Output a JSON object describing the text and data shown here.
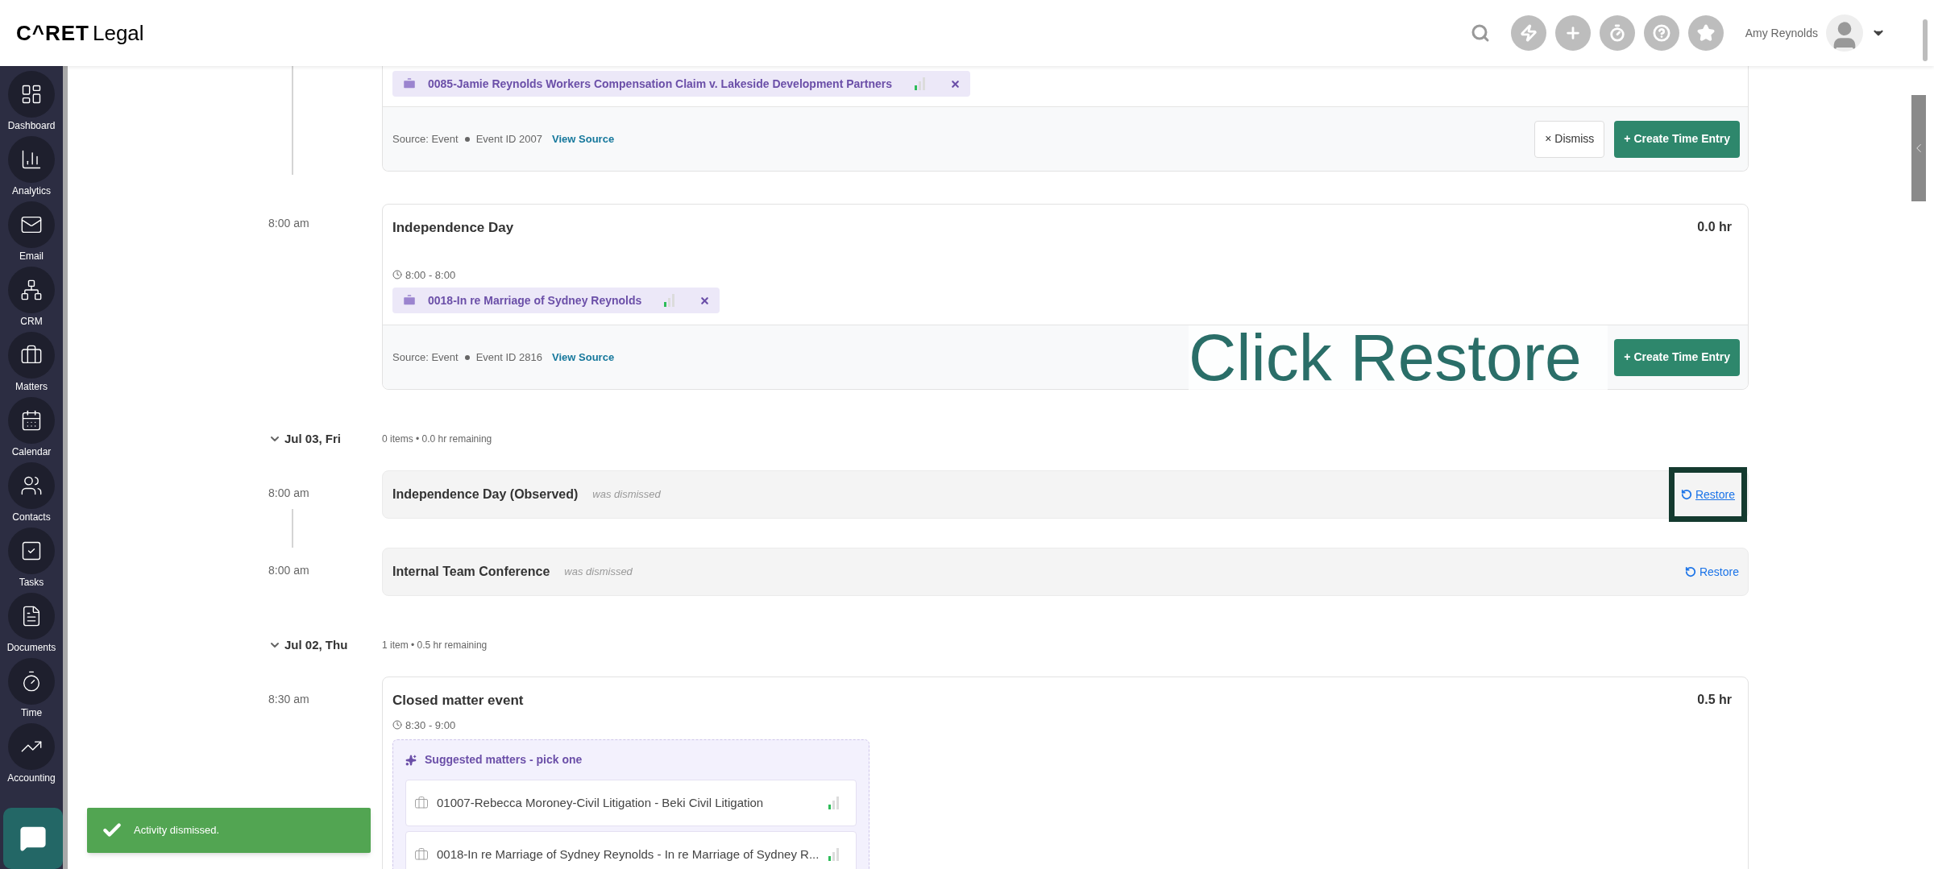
{
  "header": {
    "logo_brand": "C^RET",
    "logo_product": "Legal",
    "user_name": "Amy Reynolds"
  },
  "sidebar": {
    "items": [
      {
        "label": "Dashboard"
      },
      {
        "label": "Analytics"
      },
      {
        "label": "Email"
      },
      {
        "label": "CRM"
      },
      {
        "label": "Matters"
      },
      {
        "label": "Calendar"
      },
      {
        "label": "Contacts"
      },
      {
        "label": "Tasks"
      },
      {
        "label": "Documents"
      },
      {
        "label": "Time"
      },
      {
        "label": "Accounting"
      }
    ]
  },
  "groups": [
    {
      "entries": [
        {
          "kind": "event_partial",
          "matters": [
            "0085-Jamie Reynolds Workers Compensation Claim v. Lakeside Development Partners"
          ],
          "source": "Source: Event",
          "event_id": "Event ID 2007",
          "link": "View Source",
          "buttons": [
            {
              "kind": "dismiss",
              "label": "× Dismiss"
            },
            {
              "kind": "create",
              "label": "+ Create Time Entry"
            }
          ]
        },
        {
          "kind": "event",
          "time": "8:00 am",
          "title": "Independence Day",
          "hours": "0.0 hr",
          "range": "8:00 - 8:00",
          "matters": [
            "0018-In re Marriage of Sydney Reynolds"
          ],
          "source": "Source: Event",
          "event_id": "Event ID 2816",
          "link": "View Source",
          "buttons": [
            {
              "kind": "create",
              "label": "+ Create Time Entry"
            }
          ]
        }
      ]
    },
    {
      "header": {
        "date": "Jul 03, Fri",
        "summary": "0 items • 0.0 hr remaining",
        "expanded": true
      },
      "entries": [
        {
          "kind": "dismissed",
          "time": "8:00 am",
          "title": "Independence Day (Observed)",
          "status": "was dismissed",
          "restore": "Restore",
          "highlighted": true
        },
        {
          "kind": "dismissed",
          "time": "8:00 am",
          "title": "Internal Team Conference",
          "status": "was dismissed",
          "restore": "Restore",
          "highlighted": false
        }
      ]
    },
    {
      "header": {
        "date": "Jul 02, Thu",
        "summary": "1 item • 0.5 hr remaining",
        "expanded": true
      },
      "entries": [
        {
          "kind": "suggestion",
          "time": "8:30 am",
          "title": "Closed matter event",
          "hours": "0.5 hr",
          "range": "8:30 - 9:00",
          "suggest_title": "Suggested matters - pick one",
          "suggestions": [
            "01007-Rebecca Moroney-Civil Litigation - Beki Civil Litigation",
            "0018-In re Marriage of Sydney Reynolds - In re Marriage of Sydney R..."
          ]
        }
      ]
    }
  ],
  "annotation": {
    "text": "Click Restore"
  },
  "toast": {
    "message": "Activity dismissed."
  }
}
